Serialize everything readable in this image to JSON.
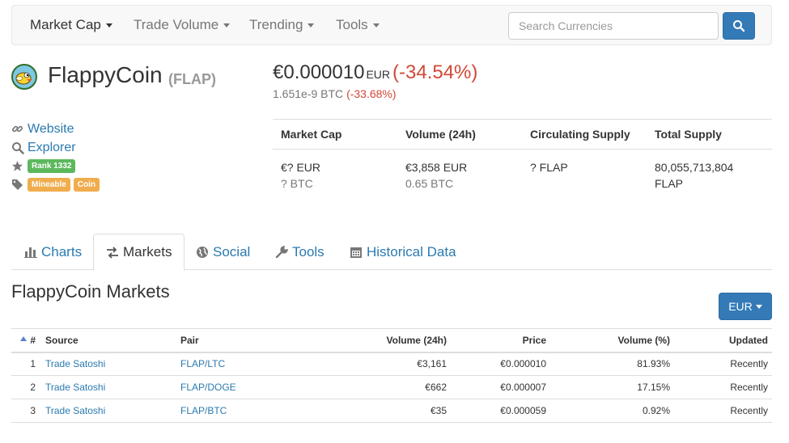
{
  "nav": {
    "items": [
      {
        "label": "Market Cap",
        "active": true
      },
      {
        "label": "Trade Volume",
        "active": false
      },
      {
        "label": "Trending",
        "active": false
      },
      {
        "label": "Tools",
        "active": false
      }
    ],
    "search_placeholder": "Search Currencies"
  },
  "coin": {
    "name": "FlappyCoin",
    "symbol": "(FLAP)",
    "price_eur": "€0.000010",
    "price_currency": "EUR",
    "price_change": "(-34.54%)",
    "price_btc": "1.651e-9 BTC",
    "price_btc_change": "(-33.68%)"
  },
  "links": {
    "website": "Website",
    "explorer": "Explorer",
    "rank": "Rank 1332",
    "tags": [
      "Mineable",
      "Coin"
    ]
  },
  "stats": {
    "headers": [
      "Market Cap",
      "Volume (24h)",
      "Circulating Supply",
      "Total Supply"
    ],
    "market_cap_eur": "€? EUR",
    "market_cap_btc": "? BTC",
    "volume_eur": "€3,858 EUR",
    "volume_btc": "0.65 BTC",
    "circulating": "? FLAP",
    "total_supply_1": "80,055,713,804",
    "total_supply_2": "FLAP"
  },
  "tabs": [
    {
      "label": "Charts",
      "icon": "bar-chart-icon",
      "active": false
    },
    {
      "label": "Markets",
      "icon": "exchange-icon",
      "active": true
    },
    {
      "label": "Social",
      "icon": "globe-icon",
      "active": false
    },
    {
      "label": "Tools",
      "icon": "wrench-icon",
      "active": false
    },
    {
      "label": "Historical Data",
      "icon": "calendar-icon",
      "active": false
    }
  ],
  "markets": {
    "title": "FlappyCoin Markets",
    "currency_button": "EUR",
    "columns": [
      "#",
      "Source",
      "Pair",
      "Volume (24h)",
      "Price",
      "Volume (%)",
      "Updated"
    ],
    "rows": [
      {
        "rank": "1",
        "source": "Trade Satoshi",
        "pair": "FLAP/LTC",
        "volume": "€3,161",
        "price": "€0.000010",
        "volume_pct": "81.93%",
        "updated": "Recently"
      },
      {
        "rank": "2",
        "source": "Trade Satoshi",
        "pair": "FLAP/DOGE",
        "volume": "€662",
        "price": "€0.000007",
        "volume_pct": "17.15%",
        "updated": "Recently"
      },
      {
        "rank": "3",
        "source": "Trade Satoshi",
        "pair": "FLAP/BTC",
        "volume": "€35",
        "price": "€0.000059",
        "volume_pct": "0.92%",
        "updated": "Recently"
      }
    ]
  },
  "colors": {
    "link": "#2a7ab0",
    "negative": "#d14836",
    "primary_button": "#337ab7",
    "badge_green": "#5cb85c",
    "badge_orange": "#f0ad4e"
  }
}
